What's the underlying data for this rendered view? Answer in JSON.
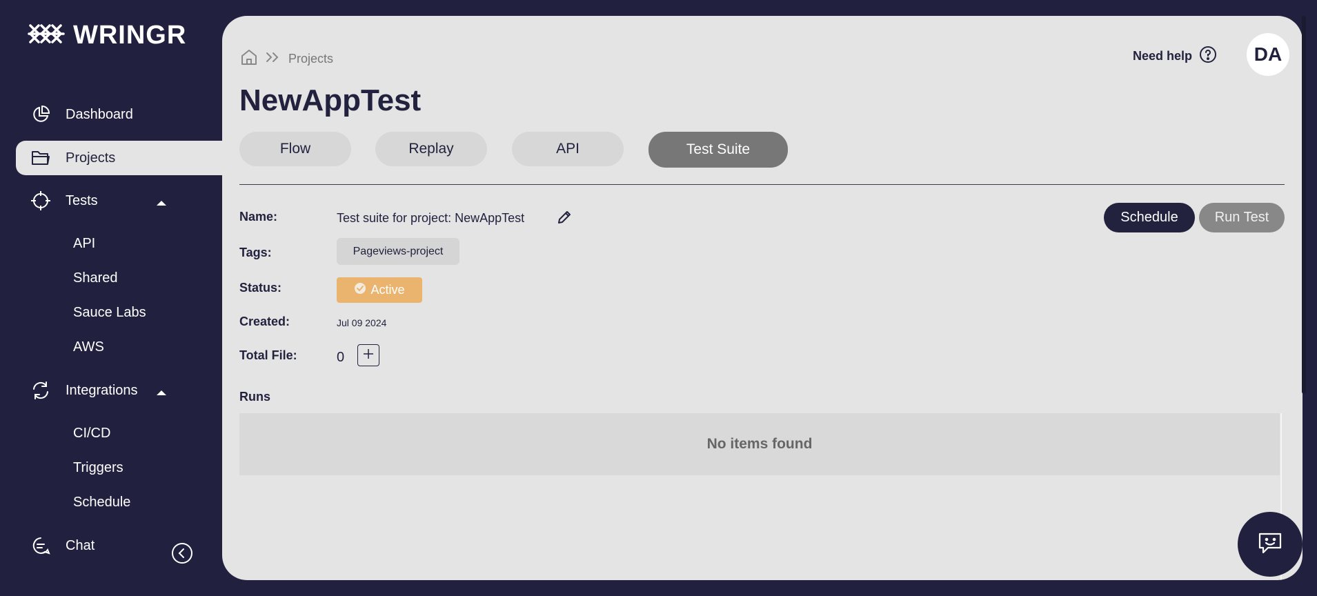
{
  "app": {
    "logo_text": "WRINGR"
  },
  "sidebar": {
    "items": [
      {
        "label": "Dashboard"
      },
      {
        "label": "Projects"
      },
      {
        "label": "Tests"
      },
      {
        "label": "Integrations"
      },
      {
        "label": "Chat"
      }
    ],
    "tests_sub": [
      "API",
      "Shared",
      "Sauce Labs",
      "AWS"
    ],
    "integrations_sub": [
      "CI/CD",
      "Triggers",
      "Schedule"
    ]
  },
  "header": {
    "breadcrumb": "Projects",
    "help_label": "Need help",
    "avatar_initials": "DA"
  },
  "main": {
    "title": "NewAppTest",
    "tabs": [
      {
        "label": "Flow"
      },
      {
        "label": "Replay"
      },
      {
        "label": "API"
      },
      {
        "label": "Test Suite"
      }
    ],
    "fields": {
      "name_label": "Name:",
      "name_value": "Test suite for project: NewAppTest",
      "tags_label": "Tags:",
      "tag_value": "Pageviews-project",
      "status_label": "Status:",
      "status_value": "Active",
      "created_label": "Created:",
      "created_value": "Jul 09 2024",
      "total_file_label": "Total File:",
      "total_file_value": "0"
    },
    "actions": {
      "schedule": "Schedule",
      "run_test": "Run Test"
    },
    "runs": {
      "label": "Runs",
      "empty": "No items found"
    }
  },
  "colors": {
    "sidebar_bg": "#21213f",
    "panel_bg": "#e4e4e4",
    "accent": "#22223e",
    "status_active": "#ebb46e",
    "tab_active": "#777777"
  }
}
